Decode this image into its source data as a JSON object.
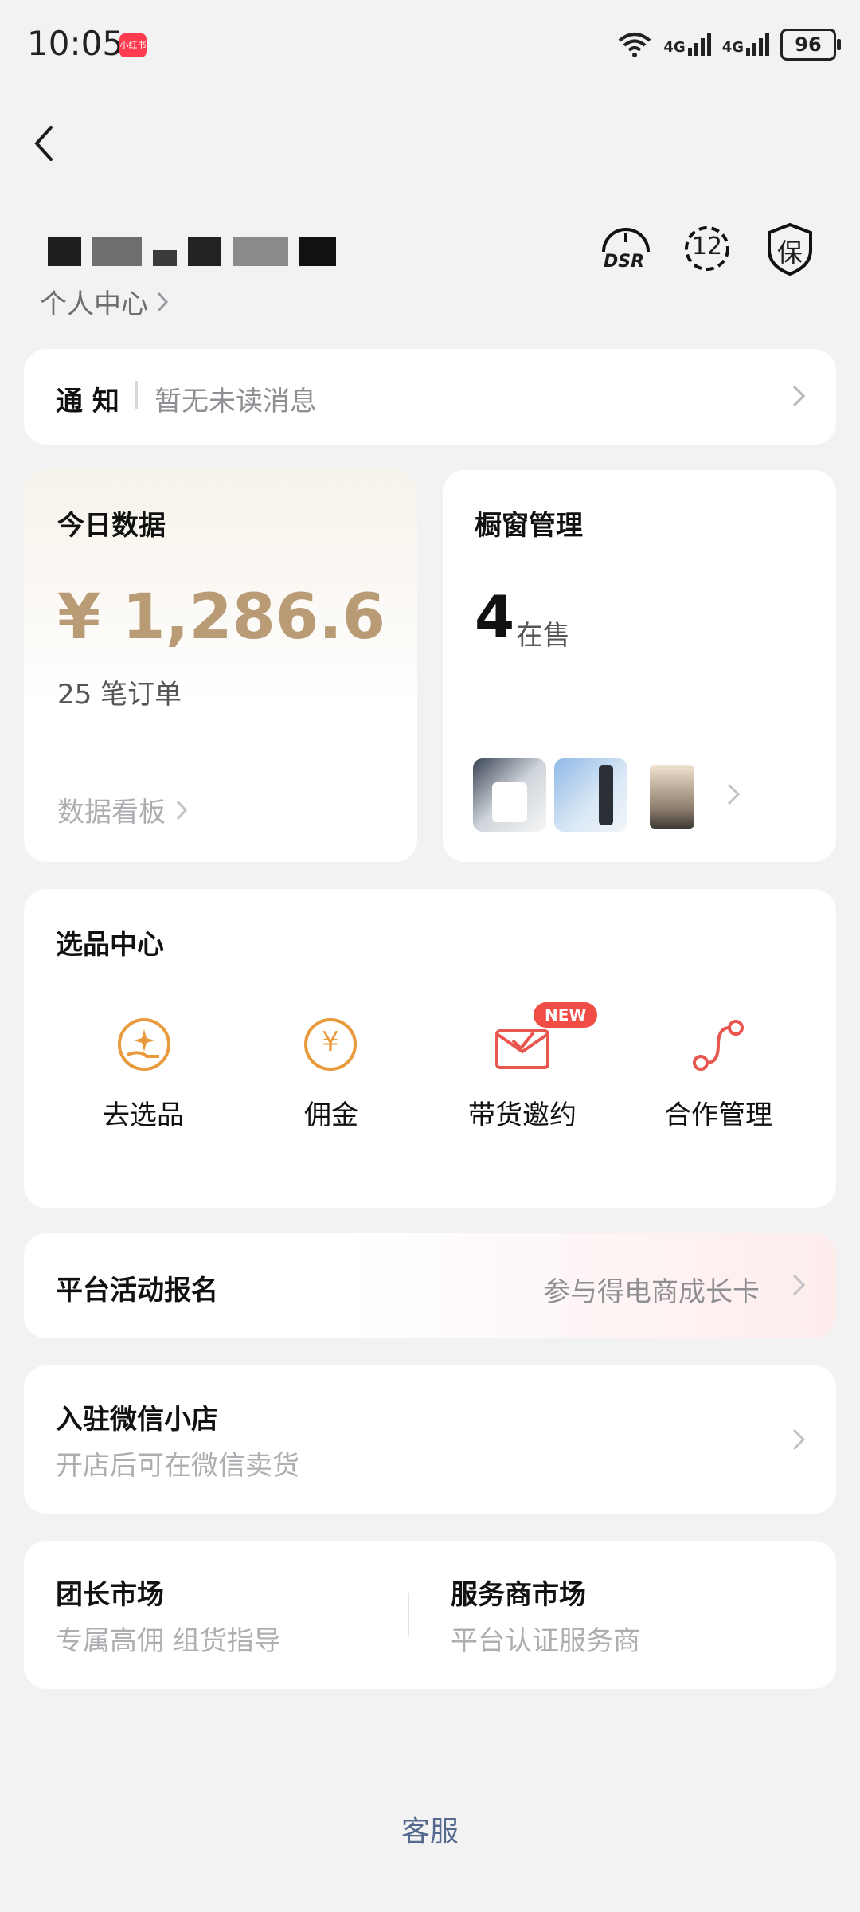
{
  "status_bar": {
    "time": "10:05",
    "app_badge": "小红书",
    "net1": "4G",
    "net2": "4G",
    "battery": "96"
  },
  "profile": {
    "link_label": "个人中心"
  },
  "header_badges": {
    "dsr": "DSR",
    "level": "12",
    "guarantee": "保"
  },
  "notification": {
    "label": "通 知",
    "text": "暂无未读消息"
  },
  "today_data": {
    "title": "今日数据",
    "amount": "¥ 1,286.6",
    "orders": "25 笔订单",
    "dashboard_link": "数据看板"
  },
  "showcase": {
    "title": "橱窗管理",
    "count": "4",
    "count_unit": "在售"
  },
  "selection_center": {
    "title": "选品中心",
    "items": [
      {
        "label": "去选品"
      },
      {
        "label": "佣金",
        "icon_text": "¥"
      },
      {
        "label": "带货邀约",
        "badge": "NEW"
      },
      {
        "label": "合作管理"
      }
    ]
  },
  "platform_activity": {
    "title": "平台活动报名",
    "link": "参与得电商成长卡"
  },
  "wechat_store": {
    "title": "入驻微信小店",
    "subtitle": "开店后可在微信卖货"
  },
  "markets": {
    "leader": {
      "title": "团长市场",
      "subtitle": "专属高佣 组货指导"
    },
    "service": {
      "title": "服务商市场",
      "subtitle": "平台认证服务商"
    }
  },
  "footer": {
    "service_label": "客服"
  },
  "colors": {
    "accent_gold": "#b99c76",
    "icon_orange": "#e89a3c",
    "badge_red": "#ef4d45",
    "link_blue": "#55698f"
  }
}
